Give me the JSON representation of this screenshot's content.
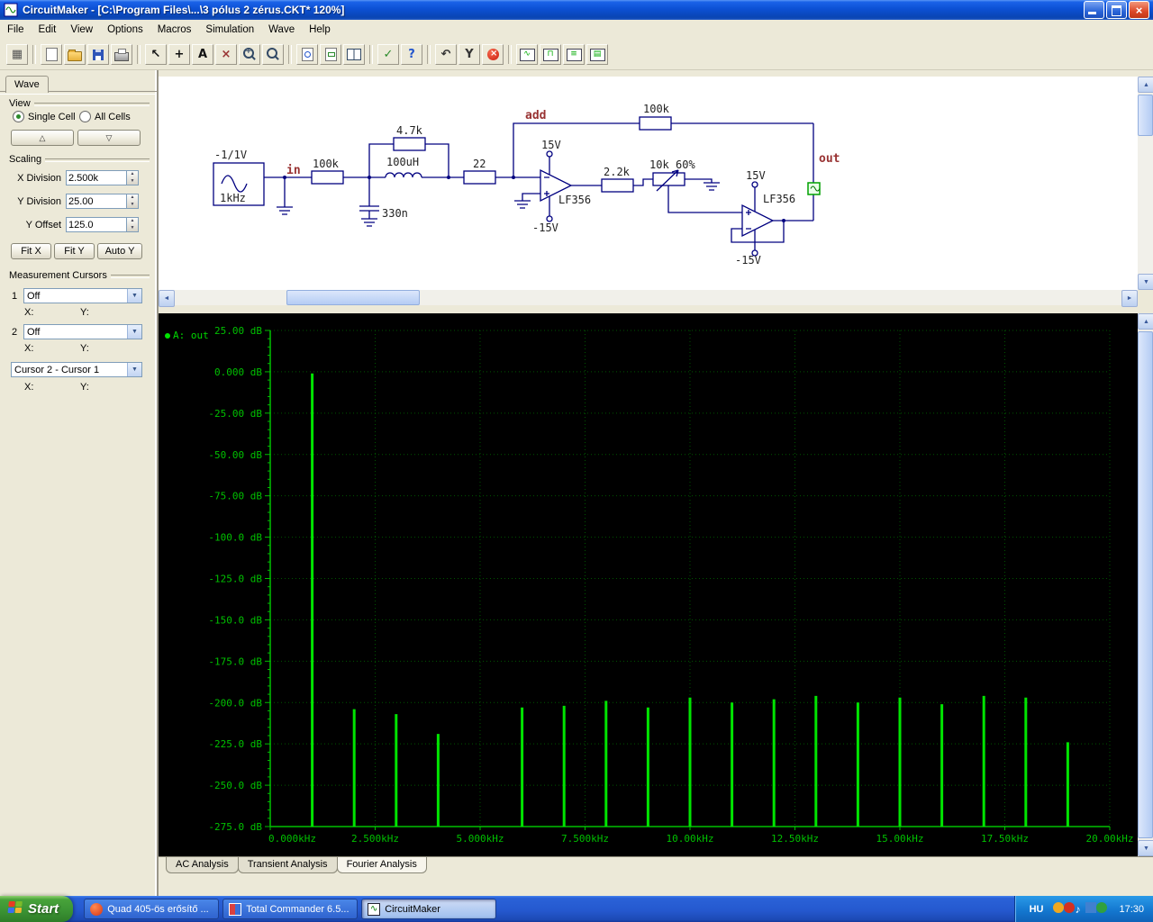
{
  "titlebar": {
    "title": "CircuitMaker - [C:\\Program Files\\...\\3 pólus 2 zérus.CKT* 120%]",
    "close_glyph": "×"
  },
  "menubar": {
    "items": [
      "File",
      "Edit",
      "View",
      "Options",
      "Macros",
      "Simulation",
      "Wave",
      "Help"
    ]
  },
  "toolbar": {
    "buttons": [
      {
        "name": "components-button",
        "type": "glyph",
        "glyph": "▦",
        "color": "#555"
      },
      {
        "type": "sep"
      },
      {
        "name": "new-button",
        "type": "page"
      },
      {
        "name": "open-button",
        "type": "folder"
      },
      {
        "name": "save-button",
        "type": "floppy"
      },
      {
        "name": "print-button",
        "type": "printer"
      },
      {
        "type": "sep"
      },
      {
        "name": "arrow-tool-button",
        "type": "glyph",
        "glyph": "↖",
        "color": "#111"
      },
      {
        "name": "place-part-button",
        "type": "glyph",
        "glyph": "+",
        "color": "#111"
      },
      {
        "name": "text-tool-button",
        "type": "glyph",
        "glyph": "A",
        "color": "#111"
      },
      {
        "name": "delete-tool-button",
        "type": "glyph",
        "glyph": "×",
        "color": "#993333"
      },
      {
        "name": "zoom-in-tool-button",
        "type": "magplus"
      },
      {
        "name": "zoom-tool-button",
        "type": "mag"
      },
      {
        "type": "sep"
      },
      {
        "name": "zoom-page-button",
        "type": "pagemag"
      },
      {
        "name": "zoom-selection-button",
        "type": "pagemag2"
      },
      {
        "name": "tile-windows-button",
        "type": "split"
      },
      {
        "type": "sep"
      },
      {
        "name": "run-simulation-button",
        "type": "glyph",
        "glyph": "✓",
        "color": "#2a8a2a"
      },
      {
        "name": "help-button",
        "type": "glyph",
        "glyph": "?",
        "color": "#2255cc"
      },
      {
        "type": "sep"
      },
      {
        "name": "reset-button",
        "type": "glyph",
        "glyph": "↶",
        "color": "#333"
      },
      {
        "name": "probe-tool-button",
        "type": "glyph",
        "glyph": "Y",
        "color": "#333"
      },
      {
        "name": "stop-simulation-button",
        "type": "stop"
      },
      {
        "type": "sep"
      },
      {
        "name": "waveforms-button",
        "type": "scope",
        "glyph": "∿"
      },
      {
        "name": "digital-scope-button",
        "type": "scope",
        "glyph": "⊓"
      },
      {
        "name": "analyses-window-button",
        "type": "scope",
        "glyph": "≡"
      },
      {
        "name": "mixed-display-button",
        "type": "scope",
        "glyph": "▤"
      }
    ]
  },
  "icons": {
    "dropdown": "▼",
    "spin_up": "▲",
    "spin_down": "▼",
    "scroll_up": "▲",
    "scroll_down": "▼",
    "scroll_left": "◄",
    "scroll_right": "►"
  },
  "wave_panel": {
    "tab": "Wave",
    "view": {
      "label": "View",
      "single_cell": "Single Cell",
      "all_cells": "All Cells",
      "up_glyph": "△",
      "down_glyph": "▽"
    },
    "scaling": {
      "label": "Scaling",
      "x_division_label": "X Division",
      "x_division": "2.500k",
      "y_division_label": "Y Division",
      "y_division": "25.00",
      "y_offset_label": "Y Offset",
      "y_offset": "125.0",
      "fit_x": "Fit X",
      "fit_y": "Fit Y",
      "auto_y": "Auto Y"
    },
    "cursors": {
      "label": "Measurement Cursors",
      "cursor1_label": "1",
      "cursor1_value": "Off",
      "cursor2_label": "2",
      "cursor2_value": "Off",
      "x_label": "X:",
      "y_label": "Y:",
      "difference_value": "Cursor 2 - Cursor 1"
    }
  },
  "schematic": {
    "source_amplitude": "-1/1V",
    "source_frequency": "1kHz",
    "in_label": "in",
    "add_label": "add",
    "out_label": "out",
    "r_input": "100k",
    "r_parallel": "4.7k",
    "inductor": "100uH",
    "capacitor": "330n",
    "r_series": "22",
    "r_feedback": "100k",
    "r_out": "2.2k",
    "pot_value": "10k",
    "pot_percent": "60%",
    "opamp1": "LF356",
    "opamp1_vplus": "15V",
    "opamp1_vminus": "-15V",
    "opamp2": "LF356",
    "opamp2_vplus": "15V",
    "opamp2_vminus": "-15V"
  },
  "analysis_tabs": {
    "items": [
      "AC Analysis",
      "Transient Analysis",
      "Fourier Analysis"
    ],
    "active": "Fourier Analysis"
  },
  "chart_data": {
    "type": "bar",
    "title": "Fourier Analysis",
    "series_label": "A: out",
    "legend_position": "top-left",
    "grid": true,
    "xlim": [
      0,
      20000
    ],
    "ylim": [
      -275,
      25
    ],
    "x_step": 2500,
    "y_step": 25,
    "x_ticks": [
      "0.000kHz",
      "2.500kHz",
      "5.000kHz",
      "7.500kHz",
      "10.00kHz",
      "12.50kHz",
      "15.00kHz",
      "17.50kHz",
      "20.00kHz"
    ],
    "y_ticks": [
      "25.00 dB",
      "0.000 dB",
      "-25.00 dB",
      "-50.00 dB",
      "-75.00 dB",
      "-100.0 dB",
      "-125.0 dB",
      "-150.0 dB",
      "-175.0 dB",
      "-200.0 dB",
      "-225.0 dB",
      "-250.0 dB",
      "-275.0 dB"
    ],
    "axis_color": "#00c000",
    "grid_color": "#005500",
    "bar_color": "#00e400",
    "bars": [
      {
        "freq_hz": 1000,
        "db": -1
      },
      {
        "freq_hz": 2000,
        "db": -204
      },
      {
        "freq_hz": 3000,
        "db": -207
      },
      {
        "freq_hz": 4000,
        "db": -219
      },
      {
        "freq_hz": 6000,
        "db": -203
      },
      {
        "freq_hz": 7000,
        "db": -202
      },
      {
        "freq_hz": 8000,
        "db": -199
      },
      {
        "freq_hz": 9000,
        "db": -203
      },
      {
        "freq_hz": 10000,
        "db": -197
      },
      {
        "freq_hz": 11000,
        "db": -200
      },
      {
        "freq_hz": 12000,
        "db": -198
      },
      {
        "freq_hz": 13000,
        "db": -196
      },
      {
        "freq_hz": 14000,
        "db": -200
      },
      {
        "freq_hz": 15000,
        "db": -197
      },
      {
        "freq_hz": 16000,
        "db": -201
      },
      {
        "freq_hz": 17000,
        "db": -196
      },
      {
        "freq_hz": 18000,
        "db": -197
      },
      {
        "freq_hz": 19000,
        "db": -224
      }
    ]
  },
  "taskbar": {
    "start_label": "Start",
    "tasks": [
      {
        "label": "Quad 405-ös erősítő ..."
      },
      {
        "label": "Total Commander 6.5..."
      },
      {
        "label": "CircuitMaker"
      }
    ],
    "tray": {
      "language": "HU",
      "clock": "17:30",
      "icons": [
        {
          "name": "scheduler-icon",
          "color": "#f0a820",
          "shape": "circle"
        },
        {
          "name": "antivirus-icon",
          "color": "#d43020",
          "shape": "circle"
        },
        {
          "name": "volume-icon",
          "color": "#ffffff",
          "shape": "note"
        },
        {
          "name": "network-icon",
          "color": "#4080d0",
          "shape": "square"
        },
        {
          "name": "messenger-icon",
          "color": "#30a040",
          "shape": "circle"
        }
      ]
    }
  }
}
